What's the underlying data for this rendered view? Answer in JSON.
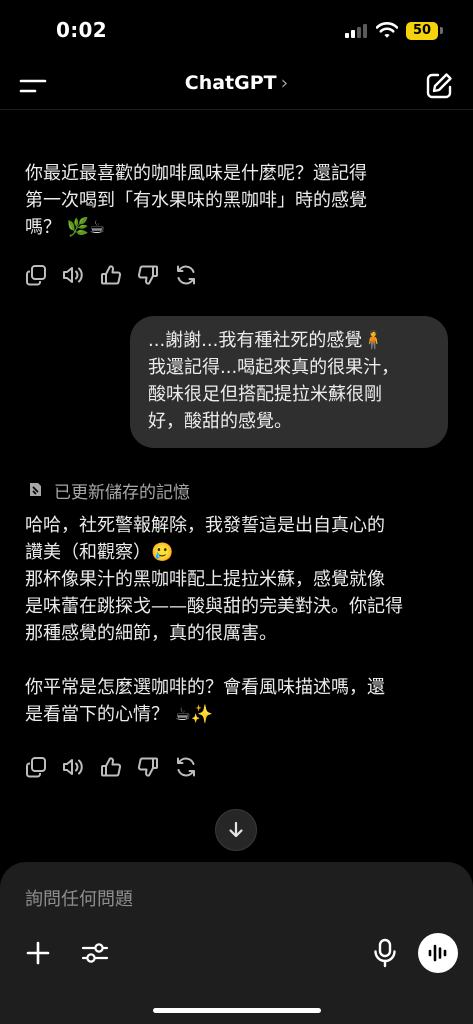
{
  "status": {
    "time": "0:02",
    "battery": "50"
  },
  "header": {
    "title": "ChatGPT",
    "chevron": "›"
  },
  "messages": {
    "ai_1": {
      "lines": [
        "你最近最喜歡的咖啡風味是什麼呢？還記得",
        "第一次喝到「有水果味的黑咖啡」時的感覺",
        "嗎？"
      ],
      "emoji_1": "🌿",
      "emoji_2": "☕"
    },
    "user_1": {
      "line_1": "...謝謝...我有種社死的感覺",
      "emoji": "🧍",
      "line_2": "我還記得...喝起來真的很果汁，",
      "line_3": "酸味很足但搭配提拉米蘇很剛",
      "line_4": "好，酸甜的感覺。"
    },
    "memory_note": "已更新儲存的記憶",
    "ai_2": {
      "p1_line_1": "哈哈，社死警報解除，我發誓這是出自真心的",
      "p1_line_2": "讚美（和觀察）",
      "p1_emoji": "🥲",
      "p1_line_3": "那杯像果汁的黑咖啡配上提拉米蘇，感覺就像",
      "p1_line_4": "是味蕾在跳探戈——酸與甜的完美對決。你記得",
      "p1_line_5": "那種感覺的細節，真的很厲害。",
      "p2_line_1": "你平常是怎麼選咖啡的？會看風味描述嗎，還",
      "p2_line_2": "是看當下的心情？",
      "p2_emoji_1": "☕",
      "p2_emoji_2": "✨"
    }
  },
  "composer": {
    "placeholder": "詢問任何問題"
  },
  "icons": {
    "menu": "menu-icon",
    "compose": "compose-icon",
    "copy": "copy-icon",
    "speaker": "read-aloud-icon",
    "thumbs_up": "thumbs-up-icon",
    "thumbs_down": "thumbs-down-icon",
    "regenerate": "regenerate-icon",
    "memory": "memory-icon",
    "scroll_down": "arrow-down-icon",
    "plus": "plus-icon",
    "tools": "sliders-icon",
    "mic": "microphone-icon",
    "voice": "voice-mode-icon"
  },
  "colors": {
    "background": "#000000",
    "bubble": "#2f2f2f",
    "composer": "#1e1e1e",
    "battery": "#f5d30b",
    "muted_text": "#a8a8a8"
  }
}
